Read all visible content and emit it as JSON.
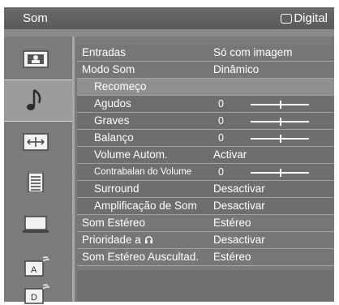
{
  "header": {
    "title": "Som",
    "source": "Digital"
  },
  "sidebar": {
    "items": [
      {
        "icon": "picture-icon",
        "selected": false
      },
      {
        "icon": "music-note-icon",
        "selected": true
      },
      {
        "icon": "screen-fit-icon",
        "selected": false
      },
      {
        "icon": "settings-list-icon",
        "selected": false
      },
      {
        "icon": "monitor-icon",
        "selected": false
      },
      {
        "icon": "analog-channel-icon",
        "selected": false
      },
      {
        "icon": "digital-channel-icon",
        "selected": false
      }
    ]
  },
  "menu": {
    "rows": [
      {
        "label": "Entradas",
        "value": "Só com imagem",
        "kind": "top"
      },
      {
        "label": "Modo Som",
        "value": "Dinâmico",
        "kind": "top"
      },
      {
        "label": "Recomeço",
        "value": "",
        "kind": "sub",
        "selected": true
      },
      {
        "label": "Agudos",
        "value": "0",
        "kind": "sub",
        "level": 0.5
      },
      {
        "label": "Graves",
        "value": "0",
        "kind": "sub",
        "level": 0.5
      },
      {
        "label": "Balanço",
        "value": "0",
        "kind": "sub",
        "level": 0.5
      },
      {
        "label": "Volume Autom.",
        "value": "Activar",
        "kind": "sub"
      },
      {
        "label": "Contrabalan do Volume",
        "value": "0",
        "kind": "sub",
        "level": 0.5
      },
      {
        "label": "Surround",
        "value": "Desactivar",
        "kind": "sub"
      },
      {
        "label": "Amplificação de Som",
        "value": "Desactivar",
        "kind": "sub"
      },
      {
        "label": "Som Estéreo",
        "value": "Estéreo",
        "kind": "top"
      },
      {
        "label": "Prioridade a",
        "value": "Desactivar",
        "kind": "top",
        "suffix_icon": "headphone-icon"
      },
      {
        "label": "Som Estéreo Auscultad.",
        "value": "Estéreo",
        "kind": "top"
      }
    ]
  }
}
